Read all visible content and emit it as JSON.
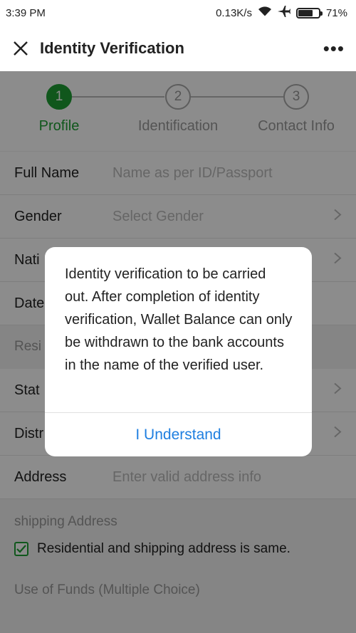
{
  "status_bar": {
    "time": "3:39 PM",
    "network_speed": "0.13K/s",
    "battery_percent": "71%",
    "battery_level": 0.71
  },
  "header": {
    "title": "Identity Verification",
    "more_label": "•••"
  },
  "stepper": {
    "steps": [
      {
        "number": "1",
        "label": "Profile",
        "active": true
      },
      {
        "number": "2",
        "label": "Identification",
        "active": false
      },
      {
        "number": "3",
        "label": "Contact Info",
        "active": false
      }
    ]
  },
  "form": {
    "full_name": {
      "label": "Full Name",
      "placeholder": "Name as per ID/Passport"
    },
    "gender": {
      "label": "Gender",
      "placeholder": "Select Gender"
    },
    "nationality": {
      "label": "Nati"
    },
    "date": {
      "label": "Date"
    },
    "residential_section": "Resi",
    "state": {
      "label": "Stat"
    },
    "district": {
      "label": "Distr"
    },
    "address": {
      "label": "Address",
      "placeholder": "Enter valid address info"
    },
    "shipping_section": "shipping Address",
    "same_address_checkbox": {
      "label": "Residential and shipping address is same.",
      "checked": true
    },
    "funds_section": "Use of Funds (Multiple Choice)"
  },
  "dialog": {
    "message": "Identity verification to be carried out. After completion of identity verification, Wallet Balance can only be withdrawn to the bank accounts in the name of the verified user.",
    "button_label": "I Understand"
  },
  "colors": {
    "accent_green": "#1e9e33",
    "link_blue": "#1f7fe0",
    "overlay": "rgba(0,0,0,0.45)"
  }
}
